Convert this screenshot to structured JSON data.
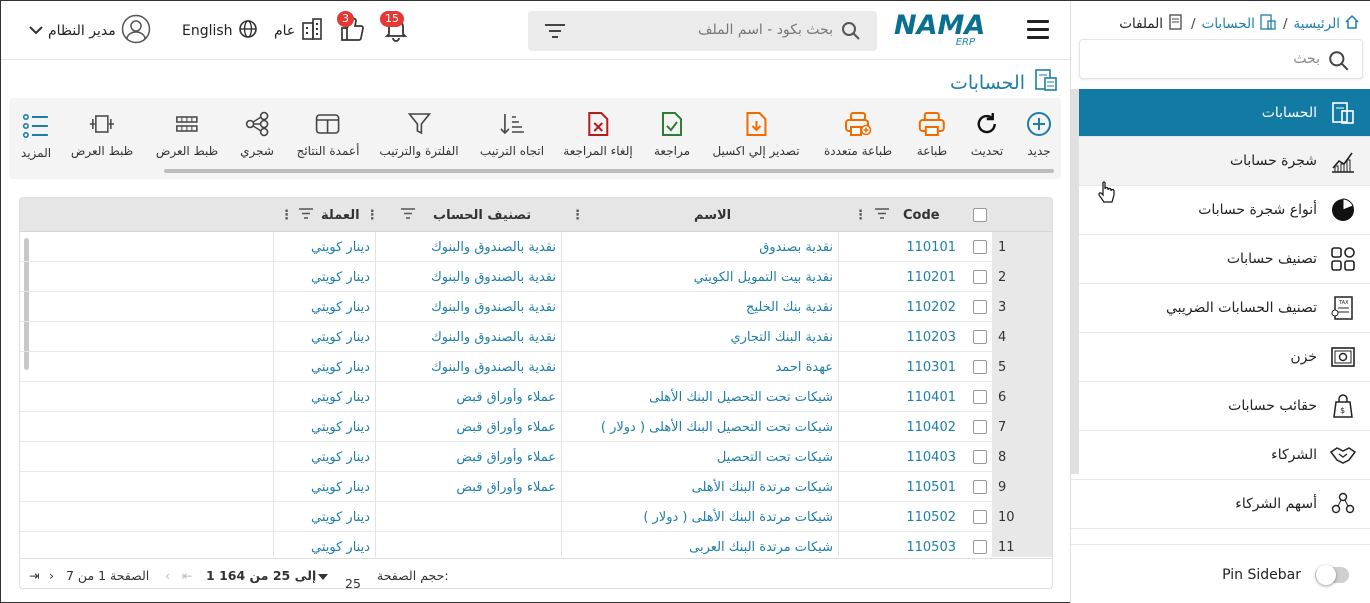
{
  "topbar": {
    "search_placeholder": "بحث بكود - اسم الملف",
    "user_name": "مدير النظام",
    "language": "English",
    "company": "عام",
    "likes_count": "3",
    "notifications_count": "15",
    "logo_text": "NAMA",
    "logo_sub": "ERP"
  },
  "breadcrumb": {
    "home": "الرئيسية",
    "accounts": "الحسابات",
    "files": "الملفات"
  },
  "sidebar": {
    "search_placeholder": "بحث",
    "items": [
      {
        "label": "الحسابات",
        "icon": "accounts-icon"
      },
      {
        "label": "شجرة حسابات",
        "icon": "chart-icon"
      },
      {
        "label": "أنواع شجرة حسابات",
        "icon": "pie-icon"
      },
      {
        "label": "تصنيف حسابات",
        "icon": "grid-icon"
      },
      {
        "label": "تصنيف الحسابات الضريبي",
        "icon": "tax-icon"
      },
      {
        "label": "خزن",
        "icon": "safe-icon"
      },
      {
        "label": "حقائب حسابات",
        "icon": "bag-icon"
      },
      {
        "label": "الشركاء",
        "icon": "handshake-icon"
      },
      {
        "label": "أسهم الشركاء",
        "icon": "shares-icon"
      }
    ],
    "pin_label": "Pin Sidebar"
  },
  "page": {
    "title": "الحسابات"
  },
  "toolbar": {
    "new": "جديد",
    "refresh": "تحديث",
    "print": "طباعة",
    "multi_print": "طباعة متعددة",
    "export_excel": "تصدير إلي اكسيل",
    "review": "مراجعة",
    "cancel_review": "إلغاء المراجعة",
    "sort_direction": "اتجاه الترتيب",
    "filter_sort": "الفلترة والترتيب",
    "result_columns": "أعمدة النتائج",
    "tree": "شجري",
    "display_density_1": "ظبط العرض",
    "display_density_2": "ظبط العرض",
    "more": "المزيد"
  },
  "grid": {
    "headers": {
      "code": "Code",
      "name": "الاسم",
      "classification": "تصنيف الحساب",
      "currency": "العملة"
    },
    "rows": [
      {
        "n": "1",
        "code": "110101",
        "name": "نقدية بصندوق",
        "cls": "نقدية بالصندوق والبنوك",
        "cur": "دينار كويتي"
      },
      {
        "n": "2",
        "code": "110201",
        "name": "نقدية بيت التمويل الكويتي",
        "cls": "نقدية بالصندوق والبنوك",
        "cur": "دينار كويتي"
      },
      {
        "n": "3",
        "code": "110202",
        "name": "نقدية بنك الخليج",
        "cls": "نقدية بالصندوق والبنوك",
        "cur": "دينار كويتي"
      },
      {
        "n": "4",
        "code": "110203",
        "name": "نقدية البنك التجاري",
        "cls": "نقدية بالصندوق والبنوك",
        "cur": "دينار كويتي"
      },
      {
        "n": "5",
        "code": "110301",
        "name": "عهدة احمد",
        "cls": "نقدية بالصندوق والبنوك",
        "cur": "دينار كويتي"
      },
      {
        "n": "6",
        "code": "110401",
        "name": "شيكات تحت التحصيل البنك الأهلى",
        "cls": "عملاء وأوراق قبض",
        "cur": "دينار كويتي"
      },
      {
        "n": "7",
        "code": "110402",
        "name": "شيكات تحت التحصيل البنك الأهلى ( دولار )",
        "cls": "عملاء وأوراق قبض",
        "cur": "دينار كويتي"
      },
      {
        "n": "8",
        "code": "110403",
        "name": "شيكات تحت التحصيل",
        "cls": "عملاء وأوراق قبض",
        "cur": "دينار كويتي"
      },
      {
        "n": "9",
        "code": "110501",
        "name": "شيكات مرتدة البنك الأهلى",
        "cls": "عملاء وأوراق قبض",
        "cur": "دينار كويتي"
      },
      {
        "n": "10",
        "code": "110502",
        "name": "شيكات مرتدة البنك الأهلى ( دولار )",
        "cls": "",
        "cur": "دينار كويتي"
      },
      {
        "n": "11",
        "code": "110503",
        "name": "شيكات مرتدة البنك العربى",
        "cls": "",
        "cur": "دينار كويتي"
      }
    ],
    "footer": {
      "page_size_label": "حجم الصفحة:",
      "page_size": "25",
      "range": "1 إلى 25 من 164",
      "page_info": "الصفحة 1 من 7"
    }
  }
}
